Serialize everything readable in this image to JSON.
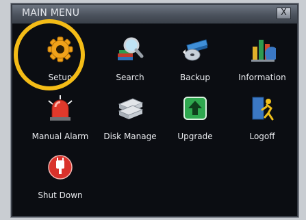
{
  "window": {
    "title": "MAIN MENU",
    "close_label": "X"
  },
  "menu_items": [
    {
      "label": "Setup",
      "icon": "gear-icon"
    },
    {
      "label": "Search",
      "icon": "search-icon"
    },
    {
      "label": "Backup",
      "icon": "backup-icon"
    },
    {
      "label": "Information",
      "icon": "information-icon"
    },
    {
      "label": "Manual Alarm",
      "icon": "alarm-icon"
    },
    {
      "label": "Disk Manage",
      "icon": "disk-icon"
    },
    {
      "label": "Upgrade",
      "icon": "upgrade-icon"
    },
    {
      "label": "Logoff",
      "icon": "logoff-icon"
    },
    {
      "label": "Shut Down",
      "icon": "power-icon"
    }
  ],
  "colors": {
    "highlight_ring": "#f4bc17",
    "window_bg": "#0b0d12"
  }
}
